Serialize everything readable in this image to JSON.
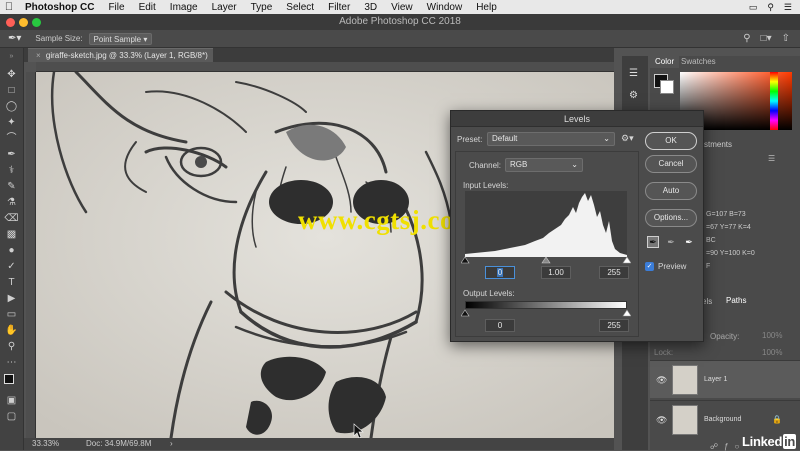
{
  "menubar": {
    "app": "Photoshop CC",
    "items": [
      "File",
      "Edit",
      "Image",
      "Layer",
      "Type",
      "Select",
      "Filter",
      "3D",
      "View",
      "Window",
      "Help"
    ]
  },
  "window": {
    "title": "Adobe Photoshop CC 2018"
  },
  "options": {
    "sample_size_label": "Sample Size:",
    "sample_size_value": "Point Sample"
  },
  "document": {
    "tab_title": "giraffe-sketch.jpg @ 33.3% (Layer 1, RGB/8*) *",
    "zoom": "33.33%",
    "doc_size": "Doc: 34.9M/69.8M"
  },
  "panels": {
    "color_tab": "Color",
    "swatches_tab": "Swatches",
    "adjustments_fragment": "stments",
    "channels_fragment": "els",
    "paths_tab": "Paths",
    "opacity_label": "Opacity:",
    "opacity_value": "100%",
    "fill_value": "100%",
    "lock_label": "Lock:",
    "info_lines": [
      "G=107 B=73",
      "=67 Y=77 K=4",
      "BC",
      "=90 Y=100 K=0",
      "F"
    ],
    "layers": [
      {
        "name": "Layer 1",
        "visible": true
      },
      {
        "name": "Background",
        "visible": true,
        "locked": true
      }
    ]
  },
  "dialog": {
    "title": "Levels",
    "preset_label": "Preset:",
    "preset_value": "Default",
    "channel_label": "Channel:",
    "channel_value": "RGB",
    "input_levels_label": "Input Levels:",
    "input_black": "0",
    "input_mid": "1.00",
    "input_white": "255",
    "output_levels_label": "Output Levels:",
    "output_black": "0",
    "output_white": "255",
    "buttons": {
      "ok": "OK",
      "cancel": "Cancel",
      "auto": "Auto",
      "options": "Options..."
    },
    "preview_label": "Preview",
    "preview_checked": true
  },
  "watermark": {
    "text": "www.cgtsj.com"
  },
  "brand": {
    "text": "Linked",
    "badge": "in"
  },
  "colors": {
    "accent": "#f0e000",
    "dialog_bg": "#4b4b4b",
    "button_default_border": "#cfcfcf"
  }
}
